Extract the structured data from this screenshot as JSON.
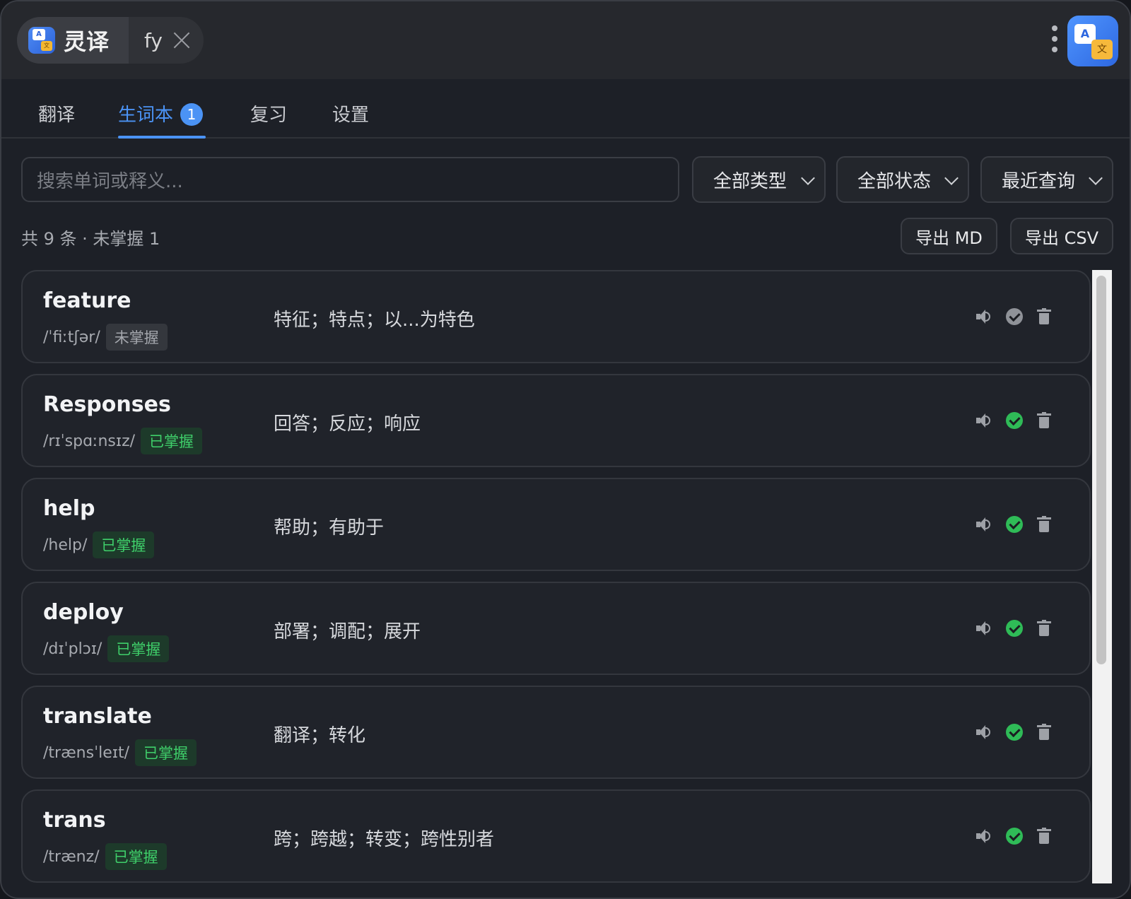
{
  "app": {
    "name": "灵译",
    "tab_label": "fy"
  },
  "tabs": [
    {
      "label": "翻译"
    },
    {
      "label": "生词本",
      "badge": "1"
    },
    {
      "label": "复习"
    },
    {
      "label": "设置"
    }
  ],
  "filters": {
    "search_placeholder": "搜索单词或释义...",
    "type": "全部类型",
    "status": "全部状态",
    "sort": "最近查询"
  },
  "summary": "共 9 条 · 未掌握 1",
  "export": {
    "md": "导出 MD",
    "csv": "导出 CSV"
  },
  "words": [
    {
      "word": "feature",
      "phonetic": "/ˈfiːtʃər/",
      "status": "未掌握",
      "mastered": false,
      "meaning": "特征；特点；以...为特色"
    },
    {
      "word": "Responses",
      "phonetic": "/rɪˈspɑːnsɪz/",
      "status": "已掌握",
      "mastered": true,
      "meaning": "回答；反应；响应"
    },
    {
      "word": "help",
      "phonetic": "/help/",
      "status": "已掌握",
      "mastered": true,
      "meaning": "帮助；有助于"
    },
    {
      "word": "deploy",
      "phonetic": "/dɪˈplɔɪ/",
      "status": "已掌握",
      "mastered": true,
      "meaning": "部署；调配；展开"
    },
    {
      "word": "translate",
      "phonetic": "/trænsˈleɪt/",
      "status": "已掌握",
      "mastered": true,
      "meaning": "翻译；转化"
    },
    {
      "word": "trans",
      "phonetic": "/trænz/",
      "status": "已掌握",
      "mastered": true,
      "meaning": "跨；跨越；转变；跨性别者"
    }
  ],
  "colors": {
    "accent": "#4b93f5",
    "mastered": "#2fbb57",
    "background": "#1d2027"
  }
}
